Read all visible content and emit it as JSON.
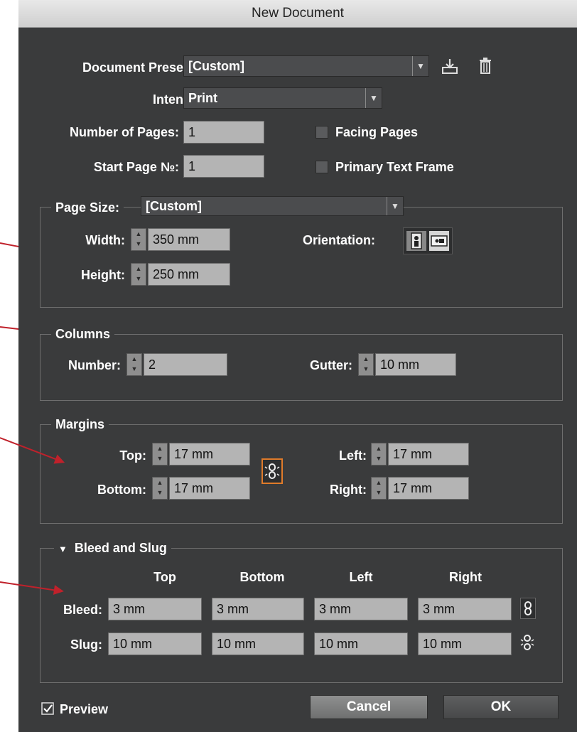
{
  "window": {
    "title": "New Document"
  },
  "top": {
    "preset_label": "Document Preset:",
    "preset_value": "[Custom]",
    "intent_label": "Intent:",
    "intent_value": "Print",
    "pages_label": "Number of Pages:",
    "pages_value": "1",
    "start_label": "Start Page №:",
    "start_value": "1",
    "facing_label": "Facing Pages",
    "facing_checked": false,
    "primary_label": "Primary Text Frame",
    "primary_checked": false
  },
  "page_size": {
    "label": "Page Size:",
    "value": "[Custom]",
    "width_label": "Width:",
    "width_value": "350 mm",
    "height_label": "Height:",
    "height_value": "250 mm",
    "orientation_label": "Orientation:",
    "orientation_selected": "landscape"
  },
  "columns": {
    "legend": "Columns",
    "number_label": "Number:",
    "number_value": "2",
    "gutter_label": "Gutter:",
    "gutter_value": "10 mm"
  },
  "margins": {
    "legend": "Margins",
    "top_label": "Top:",
    "top_value": "17 mm",
    "bottom_label": "Bottom:",
    "bottom_value": "17 mm",
    "left_label": "Left:",
    "left_value": "17 mm",
    "right_label": "Right:",
    "right_value": "17 mm"
  },
  "bleed_slug": {
    "legend": "Bleed and Slug",
    "headers": [
      "Top",
      "Bottom",
      "Left",
      "Right"
    ],
    "bleed_label": "Bleed:",
    "bleed_values": [
      "3 mm",
      "3 mm",
      "3 mm",
      "3 mm"
    ],
    "slug_label": "Slug:",
    "slug_values": [
      "10 mm",
      "10 mm",
      "10 mm",
      "10 mm"
    ]
  },
  "footer": {
    "preview_label": "Preview",
    "preview_checked": true,
    "cancel_label": "Cancel",
    "ok_label": "OK"
  },
  "colors": {
    "dialog_bg": "#3a3b3c",
    "field_bg": "#b4b4b4",
    "annotation_arrow": "#c0212b",
    "focus_ring": "#e07b2a"
  }
}
